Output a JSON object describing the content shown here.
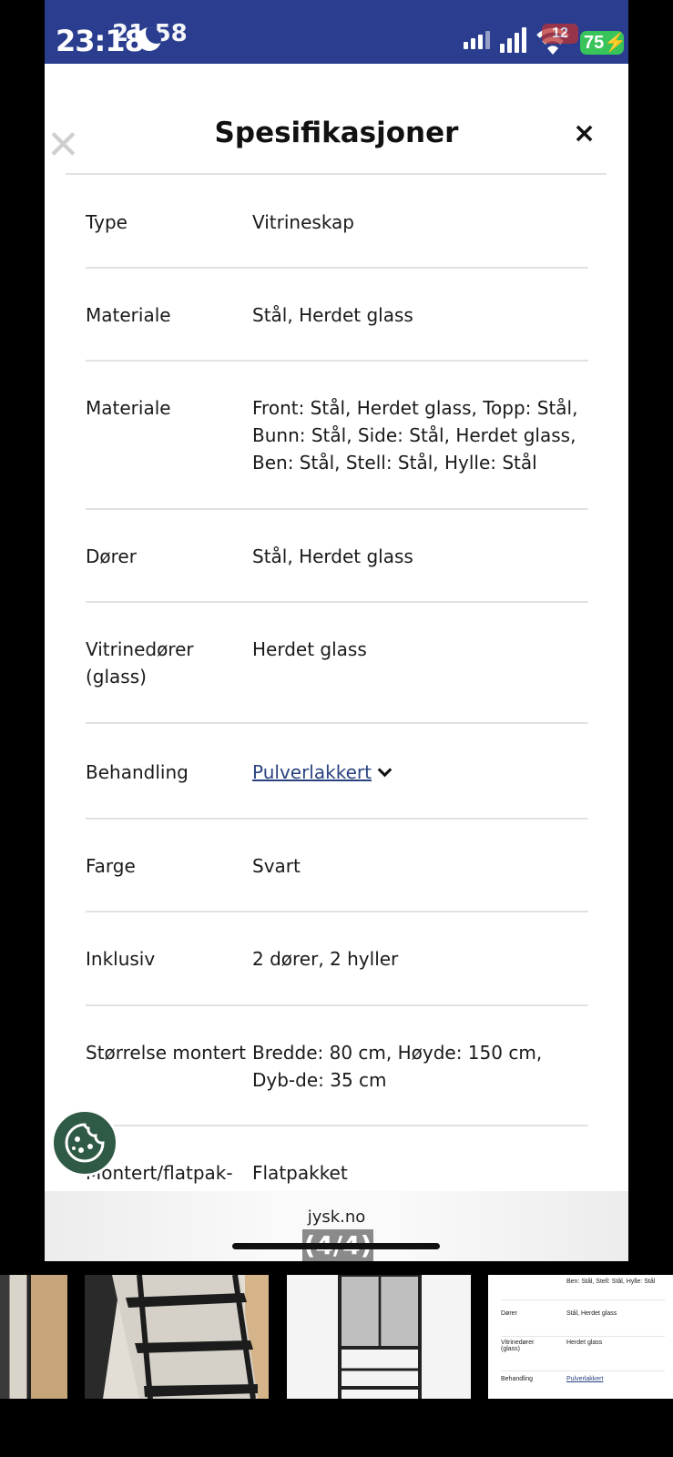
{
  "status_bar": {
    "time": "23:18",
    "time_overlay": "21:58",
    "notification_count": "12",
    "battery": "75"
  },
  "modal": {
    "title": "Spesifikasjoner",
    "close_label": "×",
    "rows": [
      {
        "label": "Type",
        "value": "Vitrineskap"
      },
      {
        "label": "Materiale",
        "value": "Stål, Herdet glass"
      },
      {
        "label": "Materiale",
        "value": "Front: Stål, Herdet glass, Topp: Stål, Bunn: Stål, Side: Stål, Herdet glass, Ben: Stål, Stell: Stål, Hylle: Stål"
      },
      {
        "label": "Dører",
        "value": "Stål, Herdet glass"
      },
      {
        "label": "Vitrinedører (glass)",
        "value": "Herdet glass"
      },
      {
        "label": "Behandling",
        "value": "Pulverlakkert",
        "is_link": true
      },
      {
        "label": "Farge",
        "value": "Svart"
      },
      {
        "label": "Inklusiv",
        "value": "2 dører, 2 hyller"
      },
      {
        "label": "Størrelse montert",
        "value": "Bredde: 80 cm, Høyde: 150 cm, Dyb-de: 35 cm"
      },
      {
        "label": "Montert/flatpak-",
        "value": "Flatpakket"
      }
    ]
  },
  "browser": {
    "url": "jysk.no",
    "page_counter": "(4/4)"
  },
  "thumbnail_preview": {
    "rows": [
      {
        "label": "",
        "value": "Ben: Stål, Stell: Stål, Hylle: Stål"
      },
      {
        "label": "Dører",
        "value": "Stål, Herdet glass"
      },
      {
        "label": "Vitrinedører (glass)",
        "value": "Herdet glass"
      },
      {
        "label": "Behandling",
        "value": "Pulverlakkert"
      }
    ]
  },
  "icons": {
    "close": "close-icon",
    "expand": "chevron-down-icon",
    "cookie": "cookie-icon",
    "signal": "cellular-signal-icon",
    "wifi": "wifi-icon",
    "battery": "battery-icon",
    "moon": "focus-moon-icon"
  },
  "colors": {
    "status_bar": "#2a3d8f",
    "link": "#2a4380",
    "cookie_button": "#2f5a45",
    "battery": "#38c45a"
  }
}
